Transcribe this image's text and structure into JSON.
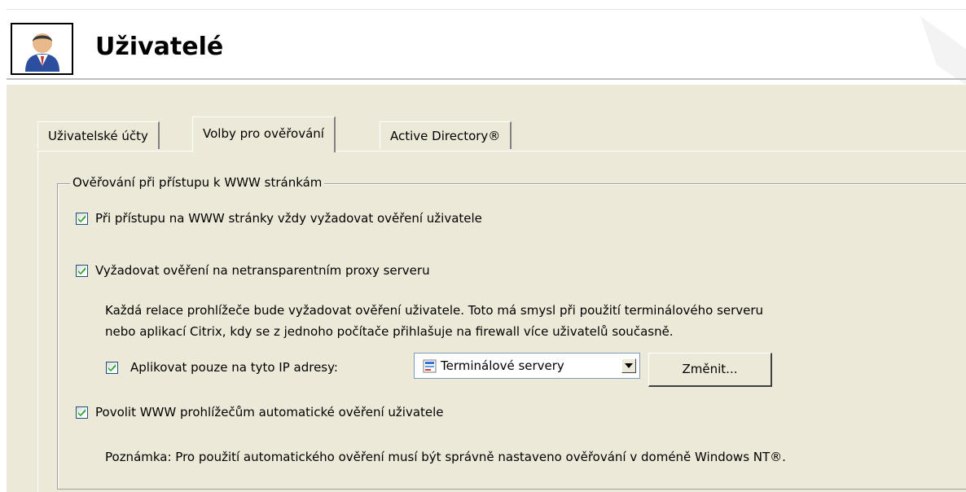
{
  "header": {
    "title": "Uživatelé",
    "icon": "user-icon"
  },
  "tabs": [
    {
      "label": "Uživatelské účty",
      "active": false
    },
    {
      "label": "Volby pro ověřování",
      "active": true
    },
    {
      "label": "Active Directory®",
      "active": false
    }
  ],
  "group": {
    "title": "Ověřování při přístupu k WWW stránkám",
    "options": [
      {
        "label": "Při přístupu na WWW stránky vždy vyžadovat ověření uživatele",
        "checked": true
      },
      {
        "label": "Vyžadovat ověření na netransparentním proxy serveru",
        "checked": true
      },
      {
        "label": "Povolit WWW prohlížečům automatické ověření uživatele",
        "checked": true
      }
    ],
    "proxy_note_line1": "Každá relace prohlížeče bude vyžadovat ověření uživatele. Toto má smysl při použití terminálového serveru",
    "proxy_note_line2": "nebo aplikací Citrix, kdy se z jednoho počítače přihlašuje na firewall více uživatelů současně.",
    "ip_restrict": {
      "label": "Aplikovat pouze na tyto IP adresy:",
      "checked": true,
      "selected": "Terminálové servery",
      "select_icon": "ip-group-icon",
      "change_button": "Změnit..."
    },
    "auto_note": "Poznámka: Pro použití automatického ověření musí být správně nastaveno ověřování v doméně Windows NT®."
  },
  "colors": {
    "dialog_bg": "#ece9d8",
    "check_border": "#1c5180",
    "select_border": "#7f9db9"
  }
}
